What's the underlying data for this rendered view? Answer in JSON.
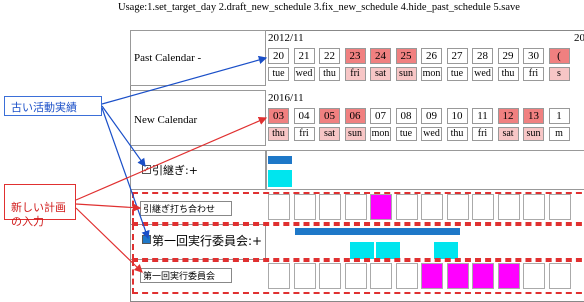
{
  "usage": "Usage:1.set_target_day 2.draft_new_schedule 3.fix_new_schedule 4.hide_past_schedule 5.save",
  "past": {
    "label": "Past Calendar -",
    "month": "2012/11",
    "month_next": "20",
    "days": [
      "20",
      "21",
      "22",
      "23",
      "24",
      "25",
      "26",
      "27",
      "28",
      "29",
      "30",
      "("
    ],
    "weekdays": [
      "tue",
      "wed",
      "thu",
      "fri",
      "sat",
      "sun",
      "mon",
      "tue",
      "wed",
      "thu",
      "fri",
      "s"
    ]
  },
  "new": {
    "label": "New Calendar",
    "month": "2016/11",
    "days": [
      "03",
      "04",
      "05",
      "06",
      "07",
      "08",
      "09",
      "10",
      "11",
      "12",
      "13",
      "1"
    ],
    "weekdays": [
      "thu",
      "fri",
      "sat",
      "sun",
      "mon",
      "tue",
      "wed",
      "thu",
      "fri",
      "sat",
      "sun",
      "m"
    ]
  },
  "rows": {
    "handover_label": "引継ぎ:+",
    "handover_input": "引継ぎ打ち合わせ",
    "committee_label": "第一回実行委員会:+",
    "committee_input": "第一回実行委員会"
  },
  "callouts": {
    "old_activity": "古い活動実績",
    "new_plan": "新しい計画\nの入力"
  },
  "colors": {
    "blue": "#1e78c8",
    "cyan": "#00e5ee",
    "magenta": "#ff00ff",
    "red": "#f08080",
    "dash": "#e03030"
  }
}
